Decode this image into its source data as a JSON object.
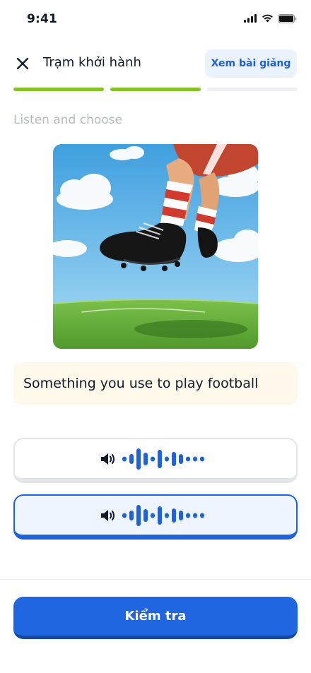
{
  "status_bar": {
    "time": "9:41"
  },
  "header": {
    "title": "Trạm khởi hành",
    "lesson_button": "Xem bài giảng"
  },
  "progress": {
    "segments": [
      1.0,
      1.0,
      0.0
    ]
  },
  "instruction": "Listen and choose",
  "illustration": {
    "icon": "football-boots-illustration"
  },
  "prompt": "Something you use to play football",
  "audio_options": [
    {
      "icon": "speaker-icon",
      "waveform": "waveform",
      "selected": false
    },
    {
      "icon": "speaker-icon",
      "waveform": "waveform",
      "selected": true
    }
  ],
  "check_button": "Kiểm tra",
  "colors": {
    "accent_blue": "#1f66e0",
    "progress_green": "#84c225",
    "prompt_bg": "#fef9ea",
    "selected_bg": "#eef5fe"
  }
}
